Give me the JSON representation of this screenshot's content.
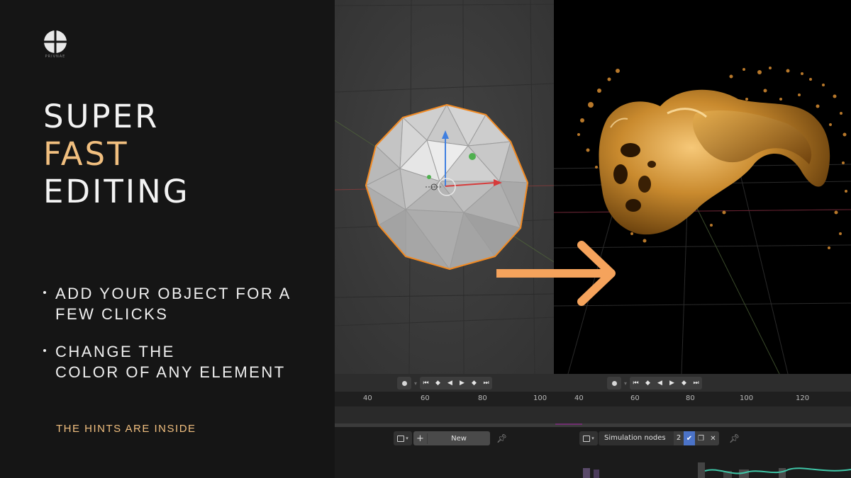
{
  "brand": {
    "logo_icon": "circle-cross-logo-icon",
    "caption": "PRIVNAE"
  },
  "headline": {
    "line1": "SUPER",
    "line2": "FAST",
    "line3": "EDITING",
    "accent_color": "#f1bf7f"
  },
  "bullets": [
    {
      "line1": "ADD YOUR OBJECT FOR A",
      "line2": "FEW CLICKS"
    },
    {
      "line1": "CHANGE THE",
      "line2": "COLOR OF ANY ELEMENT"
    }
  ],
  "hint": "THE HINTS ARE INSIDE",
  "arrow_color": "#f5a35c",
  "viewports": {
    "left": {
      "object": "icosphere",
      "selection_color": "#f08a24"
    },
    "right": {
      "object": "golden-fluid-simulation"
    }
  },
  "timeline": {
    "left_ticks": [
      "40",
      "60",
      "80",
      "100"
    ],
    "right_ticks": [
      "40",
      "60",
      "80",
      "100",
      "120"
    ],
    "transport_icons": [
      "jump-start-icon",
      "prev-keyframe-icon",
      "play-reverse-icon",
      "play-icon",
      "next-keyframe-icon",
      "jump-end-icon"
    ],
    "transport_glyphs": [
      "⏮",
      "◆",
      "◀",
      "▶",
      "◆",
      "⏭"
    ]
  },
  "node_editor": {
    "left": {
      "new_label": "New",
      "plus": "+"
    },
    "right": {
      "node_group_name": "Simulation nodes",
      "user_count": "2",
      "fake_user_icon": "shield-check-icon"
    }
  }
}
